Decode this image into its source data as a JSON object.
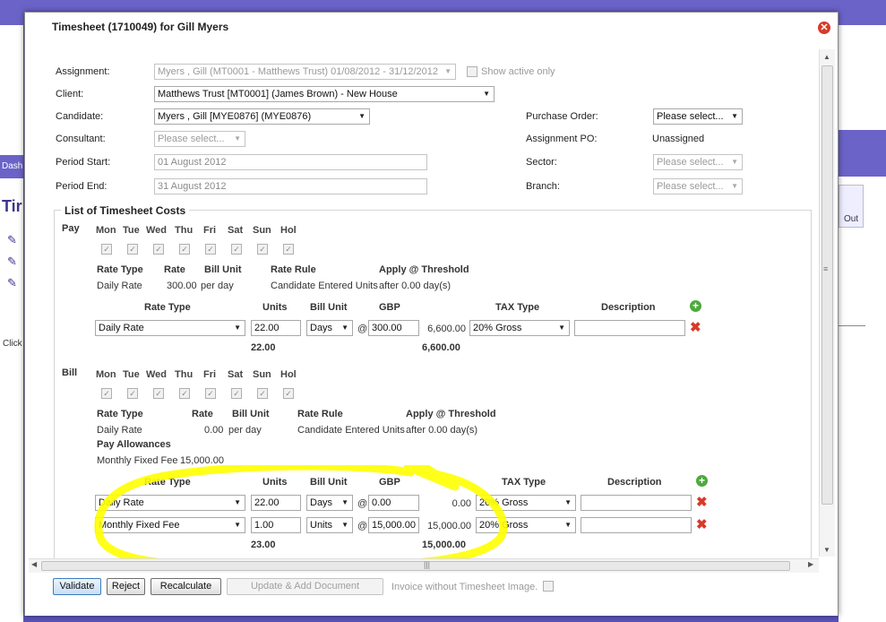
{
  "background": {
    "left_tab": "Dashb",
    "left_title": "Tir",
    "left_click": "Click",
    "right_button": "Out"
  },
  "dialog": {
    "title": "Timesheet (1710049) for Gill Myers",
    "close_icon": "close-icon"
  },
  "form": {
    "assignment_label": "Assignment:",
    "assignment_value": "Myers , Gill (MT0001 - Matthews Trust) 01/08/2012 - 31/12/2012",
    "show_active_label": "Show active only",
    "client_label": "Client:",
    "client_value": "Matthews Trust [MT0001] (James Brown) - New House",
    "candidate_label": "Candidate:",
    "candidate_value": "Myers , Gill [MYE0876] (MYE0876)",
    "consultant_label": "Consultant:",
    "consultant_value": "Please select...",
    "period_start_label": "Period Start:",
    "period_start_value": "01 August 2012",
    "period_end_label": "Period End:",
    "period_end_value": "31 August 2012",
    "purchase_order_label": "Purchase Order:",
    "purchase_order_value": "Please select...",
    "assignment_po_label": "Assignment PO:",
    "assignment_po_value": "Unassigned",
    "sector_label": "Sector:",
    "sector_value": "Please select...",
    "branch_label": "Branch:",
    "branch_value": "Please select..."
  },
  "costs": {
    "legend": "List of Timesheet Costs",
    "days": [
      "Mon",
      "Tue",
      "Wed",
      "Thu",
      "Fri",
      "Sat",
      "Sun",
      "Hol"
    ],
    "pay": {
      "label": "Pay",
      "rate_headers": {
        "rate_type": "Rate Type",
        "rate": "Rate",
        "bill_unit": "Bill Unit",
        "rate_rule": "Rate Rule",
        "apply_threshold": "Apply @ Threshold"
      },
      "rate_values": {
        "rate_type": "Daily Rate",
        "rate": "300.00",
        "bill_unit": "per day",
        "rate_rule": "Candidate Entered Units",
        "apply_threshold": "after 0.00 day(s)"
      },
      "table_headers": {
        "rate_type": "Rate Type",
        "units": "Units",
        "bill_unit": "Bill Unit",
        "currency": "GBP",
        "tax_type": "TAX Type",
        "description": "Description"
      },
      "rows": [
        {
          "rate_type": "Daily Rate",
          "units": "22.00",
          "bill_unit": "Days",
          "at": "@",
          "rate": "300.00",
          "total": "6,600.00",
          "tax_type": "20% Gross",
          "description": ""
        }
      ],
      "total_units": "22.00",
      "total_amount": "6,600.00"
    },
    "bill": {
      "label": "Bill",
      "rate_headers": {
        "rate_type": "Rate Type",
        "rate": "Rate",
        "bill_unit": "Bill Unit",
        "rate_rule": "Rate Rule",
        "apply_threshold": "Apply @ Threshold"
      },
      "rate_values": {
        "rate_type": "Daily Rate",
        "rate": "0.00",
        "bill_unit": "per day",
        "rate_rule": "Candidate Entered Units",
        "apply_threshold": "after 0.00 day(s)"
      },
      "allowances_label": "Pay Allowances",
      "allowances_value": "Monthly Fixed Fee",
      "allowances_amount": "15,000.00",
      "table_headers": {
        "rate_type": "Rate Type",
        "units": "Units",
        "bill_unit": "Bill Unit",
        "currency": "GBP",
        "tax_type": "TAX Type",
        "description": "Description"
      },
      "rows": [
        {
          "rate_type": "Daily Rate",
          "units": "22.00",
          "bill_unit": "Days",
          "at": "@",
          "rate": "0.00",
          "total": "0.00",
          "tax_type": "20% Gross",
          "description": ""
        },
        {
          "rate_type": "Monthly Fixed Fee",
          "units": "1.00",
          "bill_unit": "Units",
          "at": "@",
          "rate": "15,000.00",
          "total": "15,000.00",
          "tax_type": "20% Gross",
          "description": ""
        }
      ],
      "total_units": "23.00",
      "total_amount": "15,000.00"
    }
  },
  "footer": {
    "validate": "Validate",
    "reject": "Reject",
    "recalculate": "Recalculate",
    "update_add_doc": "Update & Add Document",
    "invoice_without_image": "Invoice without Timesheet Image."
  },
  "colors": {
    "highlight": "#ffff00",
    "delete": "#d83a2a",
    "add": "#4caa3c"
  }
}
